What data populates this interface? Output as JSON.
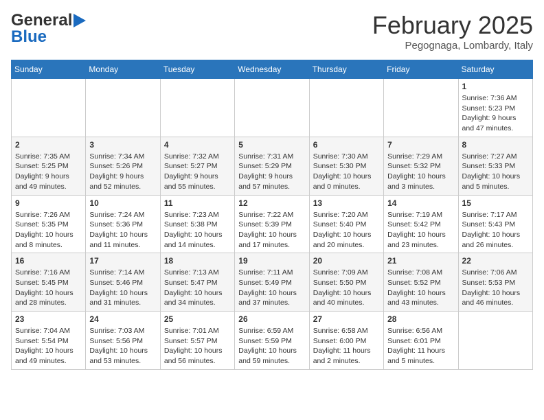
{
  "header": {
    "logo_line1": "General",
    "logo_line2": "Blue",
    "month": "February 2025",
    "location": "Pegognaga, Lombardy, Italy"
  },
  "days_of_week": [
    "Sunday",
    "Monday",
    "Tuesday",
    "Wednesday",
    "Thursday",
    "Friday",
    "Saturday"
  ],
  "weeks": [
    [
      {
        "day": "",
        "info": ""
      },
      {
        "day": "",
        "info": ""
      },
      {
        "day": "",
        "info": ""
      },
      {
        "day": "",
        "info": ""
      },
      {
        "day": "",
        "info": ""
      },
      {
        "day": "",
        "info": ""
      },
      {
        "day": "1",
        "info": "Sunrise: 7:36 AM\nSunset: 5:23 PM\nDaylight: 9 hours and 47 minutes."
      }
    ],
    [
      {
        "day": "2",
        "info": "Sunrise: 7:35 AM\nSunset: 5:25 PM\nDaylight: 9 hours and 49 minutes."
      },
      {
        "day": "3",
        "info": "Sunrise: 7:34 AM\nSunset: 5:26 PM\nDaylight: 9 hours and 52 minutes."
      },
      {
        "day": "4",
        "info": "Sunrise: 7:32 AM\nSunset: 5:27 PM\nDaylight: 9 hours and 55 minutes."
      },
      {
        "day": "5",
        "info": "Sunrise: 7:31 AM\nSunset: 5:29 PM\nDaylight: 9 hours and 57 minutes."
      },
      {
        "day": "6",
        "info": "Sunrise: 7:30 AM\nSunset: 5:30 PM\nDaylight: 10 hours and 0 minutes."
      },
      {
        "day": "7",
        "info": "Sunrise: 7:29 AM\nSunset: 5:32 PM\nDaylight: 10 hours and 3 minutes."
      },
      {
        "day": "8",
        "info": "Sunrise: 7:27 AM\nSunset: 5:33 PM\nDaylight: 10 hours and 5 minutes."
      }
    ],
    [
      {
        "day": "9",
        "info": "Sunrise: 7:26 AM\nSunset: 5:35 PM\nDaylight: 10 hours and 8 minutes."
      },
      {
        "day": "10",
        "info": "Sunrise: 7:24 AM\nSunset: 5:36 PM\nDaylight: 10 hours and 11 minutes."
      },
      {
        "day": "11",
        "info": "Sunrise: 7:23 AM\nSunset: 5:38 PM\nDaylight: 10 hours and 14 minutes."
      },
      {
        "day": "12",
        "info": "Sunrise: 7:22 AM\nSunset: 5:39 PM\nDaylight: 10 hours and 17 minutes."
      },
      {
        "day": "13",
        "info": "Sunrise: 7:20 AM\nSunset: 5:40 PM\nDaylight: 10 hours and 20 minutes."
      },
      {
        "day": "14",
        "info": "Sunrise: 7:19 AM\nSunset: 5:42 PM\nDaylight: 10 hours and 23 minutes."
      },
      {
        "day": "15",
        "info": "Sunrise: 7:17 AM\nSunset: 5:43 PM\nDaylight: 10 hours and 26 minutes."
      }
    ],
    [
      {
        "day": "16",
        "info": "Sunrise: 7:16 AM\nSunset: 5:45 PM\nDaylight: 10 hours and 28 minutes."
      },
      {
        "day": "17",
        "info": "Sunrise: 7:14 AM\nSunset: 5:46 PM\nDaylight: 10 hours and 31 minutes."
      },
      {
        "day": "18",
        "info": "Sunrise: 7:13 AM\nSunset: 5:47 PM\nDaylight: 10 hours and 34 minutes."
      },
      {
        "day": "19",
        "info": "Sunrise: 7:11 AM\nSunset: 5:49 PM\nDaylight: 10 hours and 37 minutes."
      },
      {
        "day": "20",
        "info": "Sunrise: 7:09 AM\nSunset: 5:50 PM\nDaylight: 10 hours and 40 minutes."
      },
      {
        "day": "21",
        "info": "Sunrise: 7:08 AM\nSunset: 5:52 PM\nDaylight: 10 hours and 43 minutes."
      },
      {
        "day": "22",
        "info": "Sunrise: 7:06 AM\nSunset: 5:53 PM\nDaylight: 10 hours and 46 minutes."
      }
    ],
    [
      {
        "day": "23",
        "info": "Sunrise: 7:04 AM\nSunset: 5:54 PM\nDaylight: 10 hours and 49 minutes."
      },
      {
        "day": "24",
        "info": "Sunrise: 7:03 AM\nSunset: 5:56 PM\nDaylight: 10 hours and 53 minutes."
      },
      {
        "day": "25",
        "info": "Sunrise: 7:01 AM\nSunset: 5:57 PM\nDaylight: 10 hours and 56 minutes."
      },
      {
        "day": "26",
        "info": "Sunrise: 6:59 AM\nSunset: 5:59 PM\nDaylight: 10 hours and 59 minutes."
      },
      {
        "day": "27",
        "info": "Sunrise: 6:58 AM\nSunset: 6:00 PM\nDaylight: 11 hours and 2 minutes."
      },
      {
        "day": "28",
        "info": "Sunrise: 6:56 AM\nSunset: 6:01 PM\nDaylight: 11 hours and 5 minutes."
      },
      {
        "day": "",
        "info": ""
      }
    ]
  ]
}
